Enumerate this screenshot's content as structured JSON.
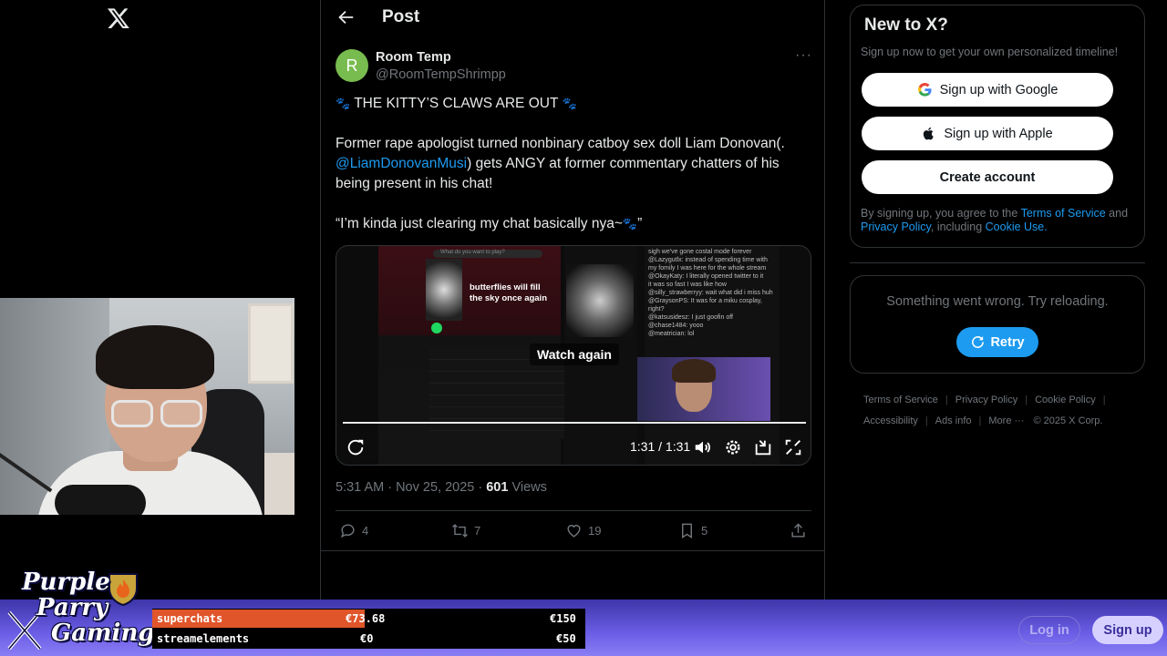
{
  "colors": {
    "accent": "#1d9bf0",
    "avatar": "#78bc4f",
    "superchat_fill": "#e0552a"
  },
  "header": {
    "title": "Post"
  },
  "post": {
    "avatar_letter": "R",
    "name": "Room Temp",
    "handle": "@RoomTempShrimpp",
    "line1": "THE KITTY’S CLAWS ARE OUT",
    "line2_a": "Former rape apologist turned nonbinary catboy sex doll Liam Donovan(.",
    "mention": "@LiamDonovanMusi",
    "line2_b": ") gets ANGY at former commentary chatters of his being present in his chat!",
    "line3": "“I’m kinda just clearing my chat basically nya~",
    "line3_end": "”",
    "media": {
      "song": "butterflies will fill the sky once again",
      "search": "What do you want to play?",
      "chat": [
        "sigh we've gone costal mode forever",
        "@Lazygutlx: instead of spending time with my fomily I was here for the whole stream",
        "@OkayKaty: I literally opened twitter to it",
        "it was so fast I was like how",
        "@silly_strawberryy: wait what did i miss huh",
        "@GraysonPS: It was for a miku cosplay, right?",
        "@katsusidesz: I just goofin off",
        "@chase1484: yooo",
        "@meatrician: lol"
      ],
      "watch_again": "Watch again",
      "time": "1:31 / 1:31",
      "progress": 1.0
    },
    "meta_time": "5:31 AM · Nov 25, 2025 · ",
    "views_count": "601",
    "views_label": " Views",
    "replies": "4",
    "reposts": "7",
    "likes": "19",
    "bookmarks": "5"
  },
  "signup": {
    "title": "New to X?",
    "subtitle": "Sign up now to get your own personalized timeline!",
    "google": "Sign up with Google",
    "apple": "Sign up with Apple",
    "create": "Create account",
    "legal_a": "By signing up, you agree to the ",
    "tos": "Terms of Service",
    "legal_b": " and ",
    "privacy": "Privacy Policy",
    "legal_c": ", including ",
    "cookie": "Cookie Use",
    "legal_d": "."
  },
  "error": {
    "message": "Something went wrong. Try reloading.",
    "retry": "Retry"
  },
  "footer": {
    "tos": "Terms of Service",
    "privacy": "Privacy Policy",
    "cookie": "Cookie Policy",
    "accessibility": "Accessibility",
    "ads": "Ads info",
    "more": "More ···",
    "copyright": "© 2025 X Corp."
  },
  "bottom": {
    "login": "Log in",
    "signup": "Sign up"
  },
  "overlay": {
    "brand_1": "Purple",
    "brand_2": "Parry",
    "brand_3": "Gaming",
    "goals": [
      {
        "name": "superchats",
        "current": "€73.68",
        "target": "€150",
        "progress": 0.49
      },
      {
        "name": "streamelements",
        "current": "€0",
        "target": "€50",
        "progress": 0
      }
    ]
  }
}
